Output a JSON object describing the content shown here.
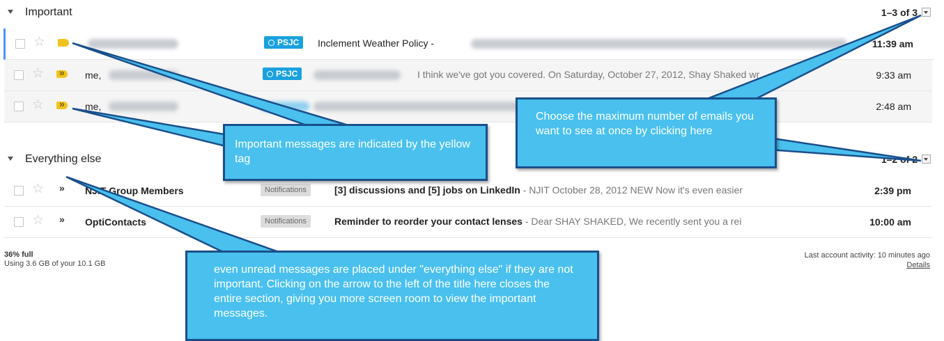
{
  "important_section": {
    "title": "Important",
    "pager": "1–3 of 3",
    "rows": [
      {
        "sender": "",
        "label": "PSJC",
        "subject": "Inclement Weather Policy -",
        "snippet": "",
        "time": "11:39 am"
      },
      {
        "sender": "me,",
        "label": "PSJC",
        "subject": "",
        "snippet": "I think we've got you covered. On Saturday, October 27, 2012, Shay Shaked wr",
        "time": "9:33 am"
      },
      {
        "sender": "me,",
        "label": "",
        "subject": "",
        "snippet": "",
        "time": "2:48 am"
      }
    ]
  },
  "everything_else_section": {
    "title": "Everything else",
    "pager": "1–2 of 2",
    "rows": [
      {
        "sender": "NJIT Group Members",
        "label": "Notifications",
        "subject": "[3] discussions and [5] jobs on LinkedIn",
        "snippet": " - NJIT October 28, 2012 NEW Now it's even easier",
        "time": "2:39 pm"
      },
      {
        "sender": "OptiContacts",
        "label": "Notifications",
        "subject": "Reminder to reorder your contact lenses",
        "snippet": " - Dear SHAY SHAKED, We recently sent you a rei",
        "time": "10:00 am"
      }
    ]
  },
  "footer": {
    "storage_percent": "36% full",
    "storage_usage": "Using 3.6 GB of your 10.1 GB",
    "last_activity": "Last account activity: 10 minutes ago",
    "details_link": "Details"
  },
  "callouts": {
    "important_tag": "Important messages are indicated by the yellow tag",
    "max_emails": "Choose the maximum number of emails you want to see at once by clicking here",
    "everything_else": "even unread messages are placed under \"everything else\" if they are not important. Clicking on the arrow to the left of the title here closes the entire section, giving you more screen room to view the important messages."
  },
  "colors": {
    "psjc_label": "#1aa1de",
    "important_marker": "#f0c420",
    "callout_fill": "#49c0ee",
    "callout_border": "#1a4f8a"
  }
}
